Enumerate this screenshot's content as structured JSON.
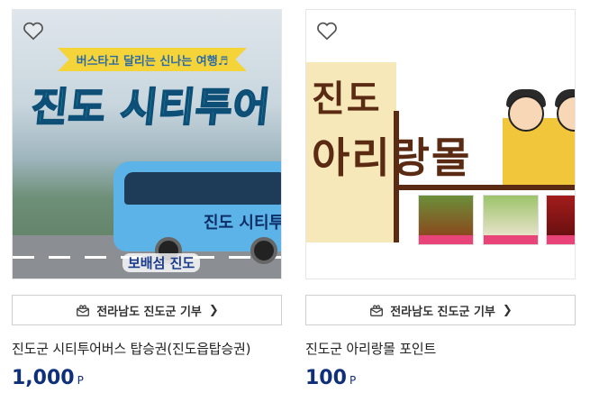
{
  "products": [
    {
      "title": "진도군 시티투어버스 탑승권(진도읍탑승권)",
      "price": "1,000",
      "unit": "P",
      "donation": "전라남도 진도군 기부",
      "image": {
        "banner": "버스타고 달리는 신나는 여행♬",
        "heading": "진도 시티투어",
        "bus_label": "진도 시티투",
        "logo": "보배섬 진도"
      }
    },
    {
      "title": "진도군 아리랑몰 포인트",
      "price": "100",
      "unit": "P",
      "donation": "전라남도 진도군 기부",
      "image": {
        "line1": "진도",
        "line2": "아리랑몰"
      }
    }
  ],
  "colors": {
    "price": "#0f2f7a",
    "accent_teal": "#2ec9c0",
    "mall_brown": "#5a2a12"
  },
  "icons": {
    "wishlist": "heart-outline-icon",
    "donate": "gift-box-icon",
    "arrow": "chevron-right-icon"
  }
}
